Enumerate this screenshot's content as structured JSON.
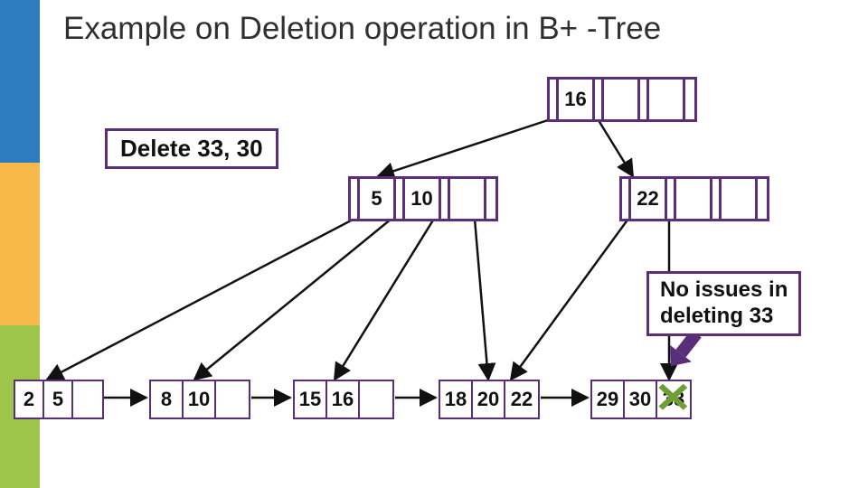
{
  "title": "Example on Deletion operation in B+ -Tree",
  "delete_label": "Delete 33, 30",
  "annot_line1": "No issues in",
  "annot_line2": "deleting 33",
  "root": {
    "keys": [
      "16",
      "",
      ""
    ]
  },
  "mid_left": {
    "keys": [
      "5",
      "10",
      ""
    ]
  },
  "mid_right": {
    "keys": [
      "22",
      "",
      ""
    ]
  },
  "leaves": [
    {
      "keys": [
        "2",
        "5",
        ""
      ]
    },
    {
      "keys": [
        "8",
        "10",
        ""
      ]
    },
    {
      "keys": [
        "15",
        "16",
        ""
      ]
    },
    {
      "keys": [
        "18",
        "20",
        "22"
      ]
    },
    {
      "keys": [
        "29",
        "30",
        "33"
      ]
    }
  ]
}
